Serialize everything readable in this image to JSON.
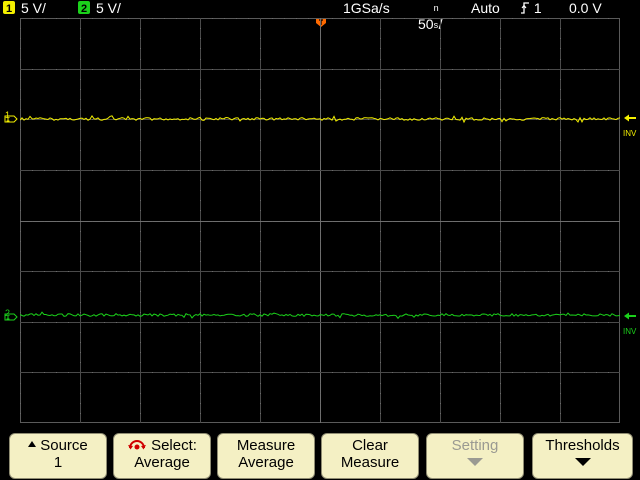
{
  "status": {
    "ch1_number": "1",
    "ch1_scale": "5 V/",
    "ch2_number": "2",
    "ch2_scale": "5 V/",
    "sample_rate": "1GSa/s",
    "timebase_value": "50",
    "timebase_unit_top": "n",
    "timebase_unit_bottom": "s",
    "timebase_slash": "/",
    "trigger_mode": "Auto",
    "trigger_source": "1",
    "trigger_level": "0.0 V"
  },
  "markers": {
    "ch1_label": "1",
    "ch2_label": "2",
    "ch1_inv": "INV",
    "ch2_inv": "INV"
  },
  "colors": {
    "ch1": "#f4f000",
    "ch2": "#1bd11b",
    "trigger_marker": "#ff6a00",
    "softkey_bg": "#f4f0c4"
  },
  "softkeys": [
    {
      "line1": "Source",
      "line2": "1",
      "icon": "up-arrow-icon"
    },
    {
      "line1": "Select:",
      "line2": "Average",
      "icon": "select-knob-icon"
    },
    {
      "line1": "Measure",
      "line2": "Average"
    },
    {
      "line1": "Clear",
      "line2": "Measure"
    },
    {
      "line1": "Setting",
      "line2": "",
      "icon": "down-arrow-icon",
      "disabled": true
    },
    {
      "line1": "Thresholds",
      "line2": "",
      "icon": "down-arrow-icon"
    }
  ]
}
